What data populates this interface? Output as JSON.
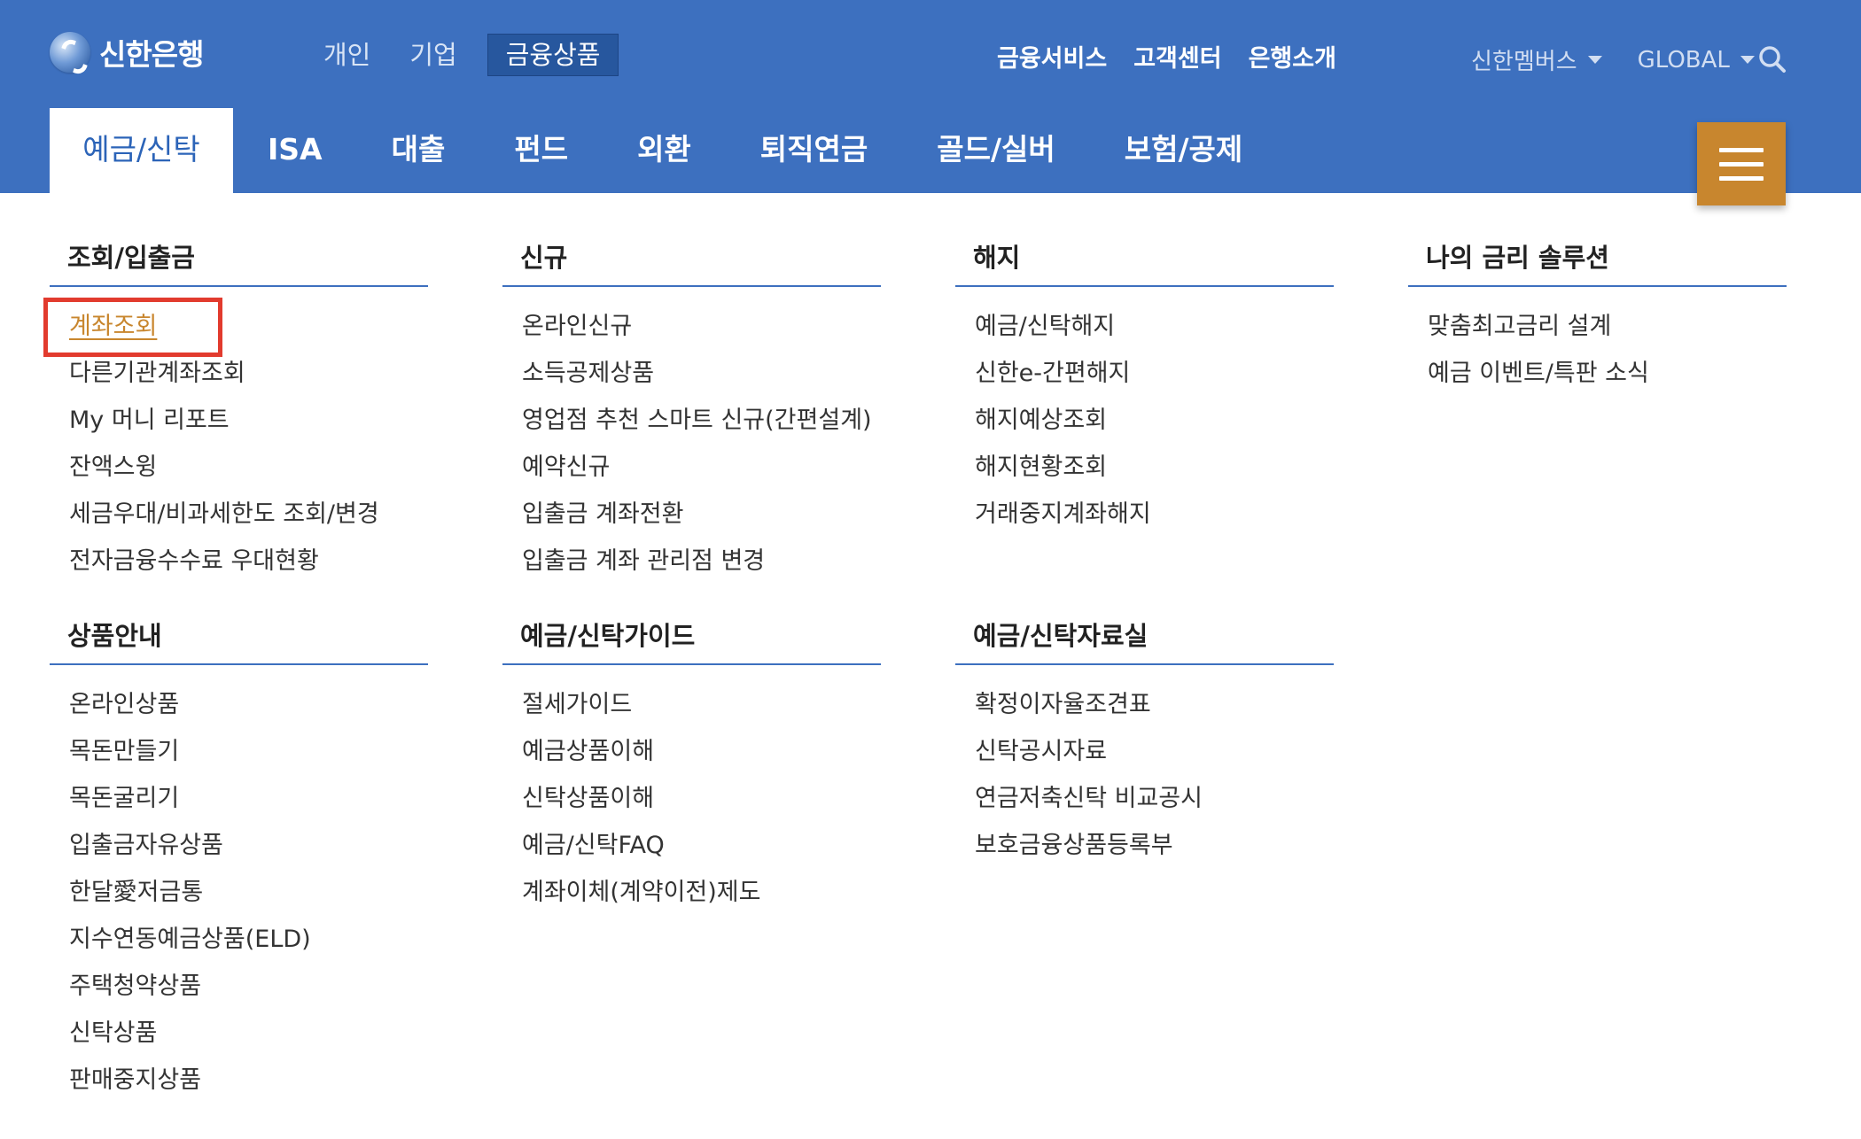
{
  "brand": {
    "name": "신한은행"
  },
  "top_nav": [
    "개인",
    "기업",
    "금융상품"
  ],
  "top_nav_active": "금융상품",
  "util_nav": [
    "금융서비스",
    "고객센터",
    "은행소개"
  ],
  "member": {
    "label": "신한멤버스",
    "global": "GLOBAL"
  },
  "main_nav": [
    "예금/신탁",
    "ISA",
    "대출",
    "펀드",
    "외환",
    "퇴직연금",
    "골드/실버",
    "보험/공제"
  ],
  "colors": {
    "header_bg": "#3d70bf",
    "accent": "#c8862e",
    "highlight_border": "#e23b2e"
  },
  "icons": {
    "search": "search-icon",
    "menu": "hamburger-menu-icon",
    "dropdown": "caret-down-icon"
  },
  "groups": [
    {
      "title": "조회/입출금",
      "items": [
        "계좌조회",
        "다른기관계좌조회",
        "My 머니 리포트",
        "잔액스윙",
        "세금우대/비과세한도 조회/변경",
        "전자금융수수료 우대현황"
      ]
    },
    {
      "title": "신규",
      "items": [
        "온라인신규",
        "소득공제상품",
        "영업점 추천 스마트 신규(간편설계)",
        "예약신규",
        "입출금 계좌전환",
        "입출금 계좌 관리점 변경"
      ]
    },
    {
      "title": "해지",
      "items": [
        "예금/신탁해지",
        "신한e-간편해지",
        "해지예상조회",
        "해지현황조회",
        "거래중지계좌해지"
      ]
    },
    {
      "title": "나의 금리 솔루션",
      "items": [
        "맞춤최고금리 설계",
        "예금 이벤트/특판 소식"
      ]
    },
    {
      "title": "상품안내",
      "items": [
        "온라인상품",
        "목돈만들기",
        "목돈굴리기",
        "입출금자유상품",
        "한달愛저금통",
        "지수연동예금상품(ELD)",
        "주택청약상품",
        "신탁상품",
        "판매중지상품"
      ]
    },
    {
      "title": "예금/신탁가이드",
      "items": [
        "절세가이드",
        "예금상품이해",
        "신탁상품이해",
        "예금/신탁FAQ",
        "계좌이체(계약이전)제도"
      ]
    },
    {
      "title": "예금/신탁자료실",
      "items": [
        "확정이자율조견표",
        "신탁공시자료",
        "연금저축신탁 비교공시",
        "보호금융상품등록부"
      ]
    }
  ]
}
